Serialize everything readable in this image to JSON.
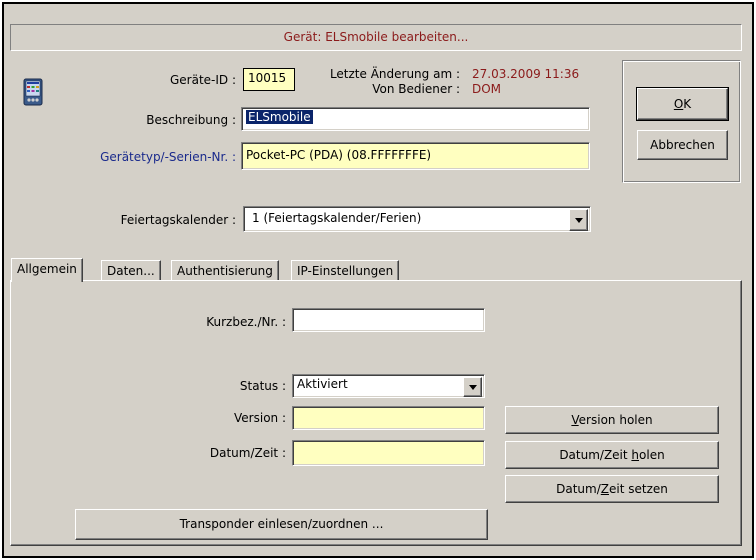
{
  "dialog": {
    "title": "Gerät: ELSmobile bearbeiten..."
  },
  "device": {
    "id_label": "Geräte-ID :",
    "id_value": "10015",
    "last_change_label": "Letzte Änderung am :",
    "last_change_value": "27.03.2009 11:36",
    "operator_label": "Von Bediener :",
    "operator_value": "DOM",
    "description_label": "Beschreibung :",
    "description_value": "ELSmobile",
    "type_label": "Gerätetyp/-Serien-Nr. :",
    "type_value": "Pocket-PC (PDA) (08.FFFFFFFE)",
    "holiday_label": "Feiertagskalender :",
    "holiday_value": "1 (Feiertagskalender/Ferien)"
  },
  "buttons": {
    "ok_accel": "O",
    "ok_rest": "K",
    "cancel": "Abbrechen"
  },
  "tabs": [
    {
      "label": "Allgemein"
    },
    {
      "label": "Daten..."
    },
    {
      "label": "Authentisierung"
    },
    {
      "label": "IP-Einstellungen"
    }
  ],
  "general": {
    "short_label": "Kurzbez./Nr. :",
    "short_value": "",
    "status_label": "Status :",
    "status_value": "Aktiviert",
    "version_label": "Version :",
    "version_value": "",
    "datetime_label": "Datum/Zeit :",
    "datetime_value": "",
    "get_version_accel": "V",
    "get_version_rest": "ersion holen",
    "get_datetime_pre": "Datum/Zeit ",
    "get_datetime_accel": "h",
    "get_datetime_rest": "olen",
    "set_datetime_pre": "Datum/",
    "set_datetime_accel": "Z",
    "set_datetime_rest": "eit setzen",
    "transponder_button": "Transponder einlesen/zuordnen ..."
  }
}
